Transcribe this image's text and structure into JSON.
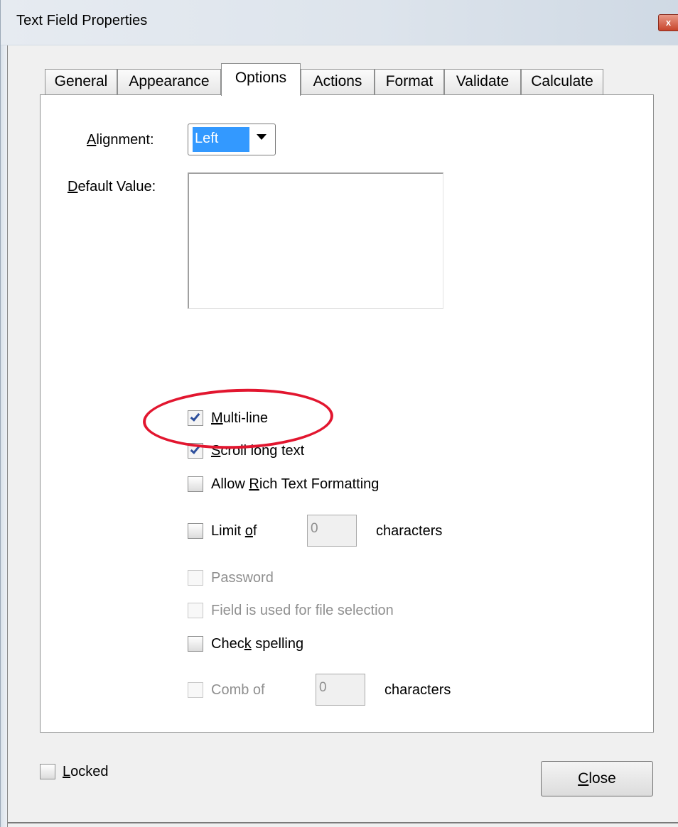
{
  "window": {
    "title": "Text Field Properties",
    "close_glyph": "x"
  },
  "tabs": [
    {
      "label": "General",
      "active": false
    },
    {
      "label": "Appearance",
      "active": false
    },
    {
      "label": "Options",
      "active": true
    },
    {
      "label": "Actions",
      "active": false
    },
    {
      "label": "Format",
      "active": false
    },
    {
      "label": "Validate",
      "active": false
    },
    {
      "label": "Calculate",
      "active": false
    }
  ],
  "options": {
    "alignment": {
      "mnemonic": "A",
      "rest": "lignment:",
      "value": "Left"
    },
    "default_value": {
      "mnemonic": "D",
      "rest": "efault Value:",
      "value": ""
    },
    "checkboxes": {
      "multi_line": {
        "pre": "",
        "mnemonic": "M",
        "post": "ulti-line",
        "checked": true,
        "enabled": true
      },
      "scroll_long_text": {
        "pre": "",
        "mnemonic": "S",
        "post": "croll long text",
        "checked": true,
        "enabled": true
      },
      "allow_rich_text": {
        "pre": "Allow ",
        "mnemonic": "R",
        "post": "ich Text Formatting",
        "checked": false,
        "enabled": true
      },
      "limit_of": {
        "pre": "Limit ",
        "mnemonic": "o",
        "post": "f",
        "checked": false,
        "enabled": true,
        "value": "0",
        "suffix": "characters"
      },
      "password": {
        "label": "Password",
        "checked": false,
        "enabled": false
      },
      "file_selection": {
        "label": "Field is used for file selection",
        "checked": false,
        "enabled": false
      },
      "check_spelling": {
        "pre": "Chec",
        "mnemonic": "k",
        "post": " spelling",
        "checked": false,
        "enabled": true
      },
      "comb_of": {
        "label": "Comb of",
        "checked": false,
        "enabled": false,
        "value": "0",
        "suffix": "characters"
      }
    }
  },
  "annotation": {
    "highlight_color": "#e2162f"
  },
  "footer": {
    "locked": {
      "mnemonic": "L",
      "post": "ocked",
      "checked": false
    },
    "close_button": {
      "mnemonic": "C",
      "post": "lose"
    }
  },
  "colors": {
    "selection": "#3399ff",
    "check_mark": "#2d4f9c",
    "disabled_text": "#8f8f8f"
  }
}
